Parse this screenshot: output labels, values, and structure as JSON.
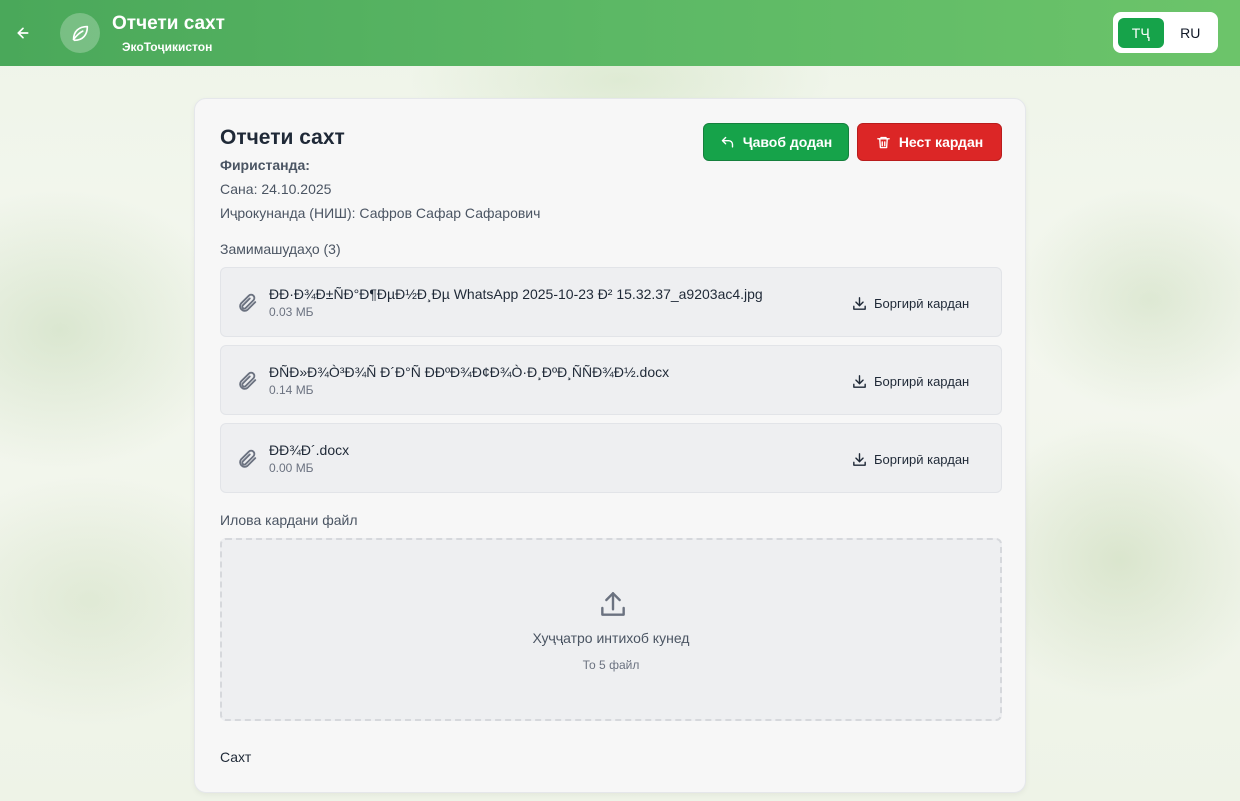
{
  "header": {
    "title": "Отчети сахт",
    "subtitle": "ЭкоТоҷикистон",
    "languages": [
      {
        "label": "ТҶ",
        "active": true
      },
      {
        "label": "RU",
        "active": false
      }
    ]
  },
  "document": {
    "title": "Отчети сахт",
    "sender_label": "Фиристанда:",
    "sender_value": "",
    "date_label": "Сана:",
    "date_value": "24.10.2025",
    "executor_label": "Иҷрокунанда (НИШ):",
    "executor_value": "Сафров Сафар Сафарович"
  },
  "actions": {
    "reply_label": "Ҷавоб додан",
    "delete_label": "Нест кардан"
  },
  "attachments": {
    "label": "Замимашудаҳо (3)",
    "download_label": "Боргирӣ кардан",
    "items": [
      {
        "name": "ÐÐ·Ð¾Ð±ÑÐ°Ð¶ÐµÐ½Ð¸Ðµ WhatsApp 2025-10-23 Ð² 15.32.37_a9203ac4.jpg",
        "size": "0.03 МБ"
      },
      {
        "name": "ÐÑÐ»Ð¾Ò³Ð¾Ñ Ð´Ð°Ñ ÐÐºÐ¾Ð¢Ð¾Ò·Ð¸ÐºÐ¸ÑÑÐ¾Ð½.docx",
        "size": "0.14 МБ"
      },
      {
        "name": "ÐÐ¾Ð´.docx",
        "size": "0.00 МБ"
      }
    ]
  },
  "upload": {
    "label": "Илова кардани файл",
    "prompt": "Хуҷҷатро интихоб кунед",
    "hint": "То 5 файл"
  },
  "content_label": "Сахт",
  "colors": {
    "header_start": "#4aa85a",
    "header_end": "#6cc46a",
    "reply_button": "#16a34a",
    "delete_button": "#dc2626"
  }
}
